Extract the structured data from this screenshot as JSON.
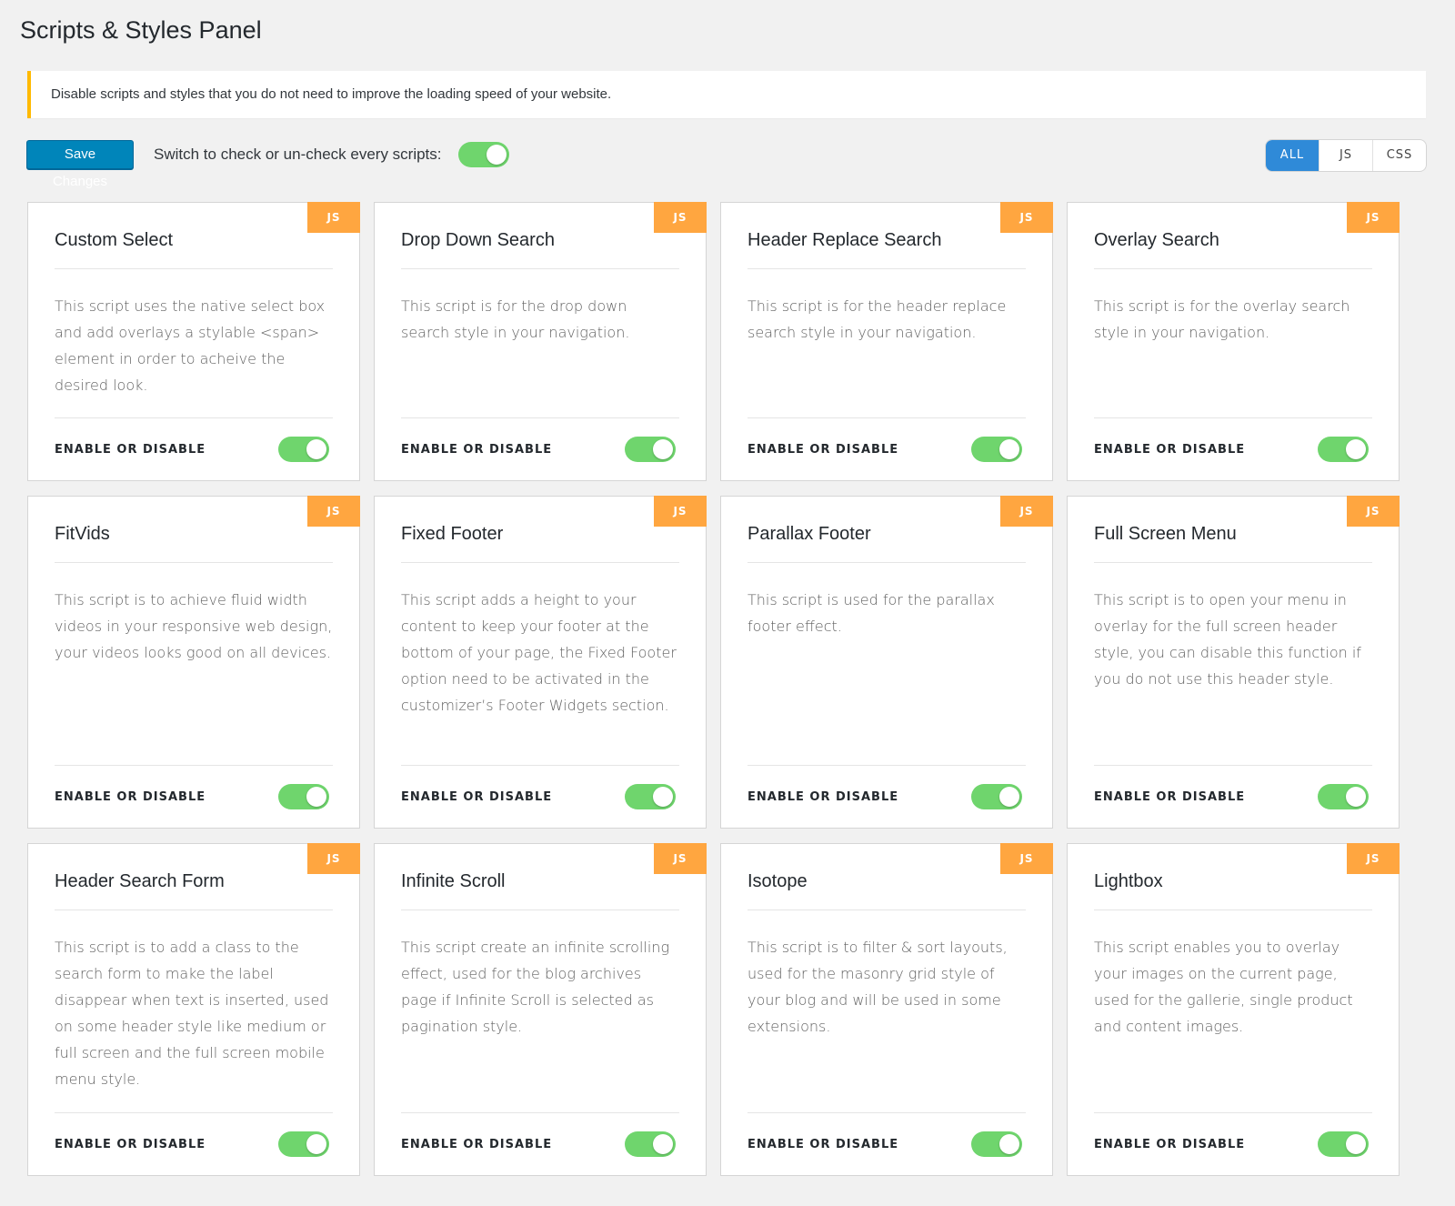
{
  "page": {
    "title": "Scripts & Styles Panel",
    "notice": "Disable scripts and styles that you do not need to improve the loading speed of your website."
  },
  "toolbar": {
    "save_label": "Save Changes",
    "switch_label": "Switch to check or un-check every scripts:",
    "master_toggle_on": true,
    "filters": [
      "ALL",
      "JS",
      "CSS"
    ],
    "active_filter": "ALL"
  },
  "colors": {
    "accent": "#0085ba",
    "toggle_on": "#6fd56d",
    "badge": "#ffa640",
    "filter_active": "#2f8ad8",
    "notice_border": "#ffb900"
  },
  "cards": [
    {
      "title": "Custom Select",
      "badge": "JS",
      "description": "This script uses the native select box and add overlays a stylable <span> element in order to acheive the desired look.",
      "footer_label": "ENABLE OR DISABLE",
      "enabled": true
    },
    {
      "title": "Drop Down Search",
      "badge": "JS",
      "description": "This script is for the drop down search style in your navigation.",
      "footer_label": "ENABLE OR DISABLE",
      "enabled": true
    },
    {
      "title": "Header Replace Search",
      "badge": "JS",
      "description": "This script is for the header replace search style in your navigation.",
      "footer_label": "ENABLE OR DISABLE",
      "enabled": true
    },
    {
      "title": "Overlay Search",
      "badge": "JS",
      "description": "This script is for the overlay search style in your navigation.",
      "footer_label": "ENABLE OR DISABLE",
      "enabled": true
    },
    {
      "title": "FitVids",
      "badge": "JS",
      "description": "This script is to achieve fluid width videos in your responsive web design, your videos looks good on all devices.",
      "footer_label": "ENABLE OR DISABLE",
      "enabled": true
    },
    {
      "title": "Fixed Footer",
      "badge": "JS",
      "description": "This script adds a height to your content to keep your footer at the bottom of your page, the Fixed Footer option need to be activated in the customizer’s Footer Widgets section.",
      "footer_label": "ENABLE OR DISABLE",
      "enabled": true
    },
    {
      "title": "Parallax Footer",
      "badge": "JS",
      "description": "This script is used for the parallax footer effect.",
      "footer_label": "ENABLE OR DISABLE",
      "enabled": true
    },
    {
      "title": "Full Screen Menu",
      "badge": "JS",
      "description": "This script is to open your menu in overlay for the full screen header style, you can disable this function if you do not use this header style.",
      "footer_label": "ENABLE OR DISABLE",
      "enabled": true
    },
    {
      "title": "Header Search Form",
      "badge": "JS",
      "description": "This script is to add a class to the search form to make the label disappear when text is inserted, used on some header style like medium or full screen and the full screen mobile menu style.",
      "footer_label": "ENABLE OR DISABLE",
      "enabled": true
    },
    {
      "title": "Infinite Scroll",
      "badge": "JS",
      "description": "This script create an infinite scrolling effect, used for the blog archives page if Infinite Scroll is selected as pagination style.",
      "footer_label": "ENABLE OR DISABLE",
      "enabled": true
    },
    {
      "title": "Isotope",
      "badge": "JS",
      "description": "This script is to filter & sort layouts, used for the masonry grid style of your blog and will be used in some extensions.",
      "footer_label": "ENABLE OR DISABLE",
      "enabled": true
    },
    {
      "title": "Lightbox",
      "badge": "JS",
      "description": "This script enables you to overlay your images on the current page, used for the gallerie, single product and content images.",
      "footer_label": "ENABLE OR DISABLE",
      "enabled": true
    }
  ]
}
